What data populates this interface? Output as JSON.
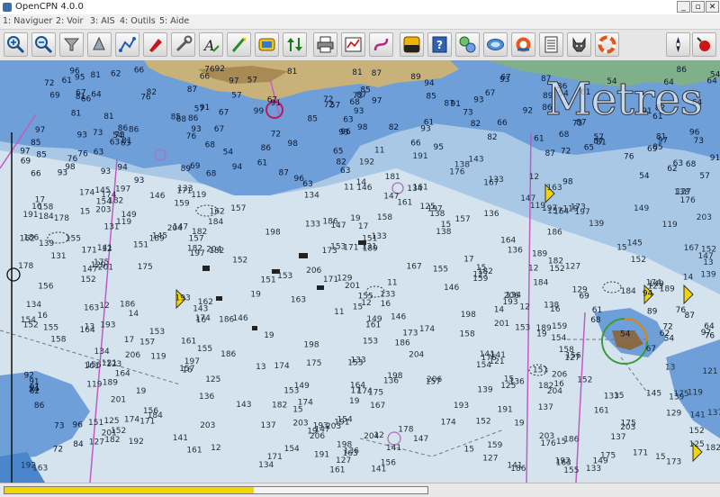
{
  "window": {
    "title": "OpenCPN 4.0.0",
    "controls": {
      "minimize": "_",
      "maximize": "▫",
      "close": "✕"
    }
  },
  "menu": {
    "items": [
      {
        "label": "1: Naviguer"
      },
      {
        "label": "2: Voir"
      },
      {
        "label": "3: AIS"
      },
      {
        "label": "4: Outils"
      },
      {
        "label": "5: Aide"
      }
    ]
  },
  "toolbar": {
    "buttons": [
      {
        "name": "zoom-in-icon"
      },
      {
        "name": "zoom-out-icon"
      },
      {
        "name": "scale-in-icon"
      },
      {
        "name": "scale-out-icon"
      },
      {
        "name": "route-icon"
      },
      {
        "name": "auto-follow-icon"
      },
      {
        "name": "settings-icon"
      },
      {
        "name": "text-icon"
      },
      {
        "name": "current-icon"
      },
      {
        "name": "tide-icon"
      },
      {
        "name": "ais-icon"
      },
      {
        "name": "print-icon"
      },
      {
        "name": "route-manager-icon"
      },
      {
        "name": "track-icon"
      },
      {
        "name": "color-scheme-icon"
      },
      {
        "name": "help-icon"
      },
      {
        "name": "plugin-icon"
      },
      {
        "name": "chart-icon"
      },
      {
        "name": "mob-icon"
      },
      {
        "name": "list-icon"
      },
      {
        "name": "dog-icon"
      },
      {
        "name": "lifebuoy-icon"
      },
      {
        "name": "compass-icon"
      },
      {
        "name": "record-icon"
      }
    ]
  },
  "chart": {
    "watermark": "Metres",
    "colors": {
      "land": "#c9b27a",
      "land_dark": "#a88a55",
      "shallow": "#6e9fd8",
      "medium": "#a9c8e6",
      "deep": "#d4e3ee",
      "route": "#c25ac2"
    },
    "soundings_deep": [
      "141",
      "147",
      "14",
      "146",
      "145",
      "15",
      "154",
      "155",
      "16",
      "161",
      "167",
      "159",
      "158",
      "151",
      "152",
      "149",
      "153",
      "156",
      "157",
      "162",
      "163",
      "164",
      "17",
      "171",
      "173",
      "175",
      "174",
      "176",
      "178",
      "18",
      "181",
      "182",
      "184",
      "186",
      "189",
      "19",
      "191",
      "193",
      "192",
      "197",
      "198",
      "201",
      "204",
      "206",
      "203",
      "136",
      "137",
      "138",
      "139",
      "133",
      "134",
      "131",
      "123",
      "125",
      "127",
      "129",
      "121",
      "119",
      "11",
      "12",
      "13",
      "143"
    ],
    "soundings_shallow": [
      "54",
      "57",
      "65",
      "73",
      "76",
      "81",
      "82",
      "84",
      "85",
      "86",
      "87",
      "89",
      "91",
      "92",
      "93",
      "94",
      "95",
      "96",
      "97",
      "98",
      "99",
      "61",
      "62",
      "63",
      "64",
      "66",
      "67",
      "68",
      "69",
      "72"
    ]
  },
  "status": {
    "progress": 0.59
  }
}
